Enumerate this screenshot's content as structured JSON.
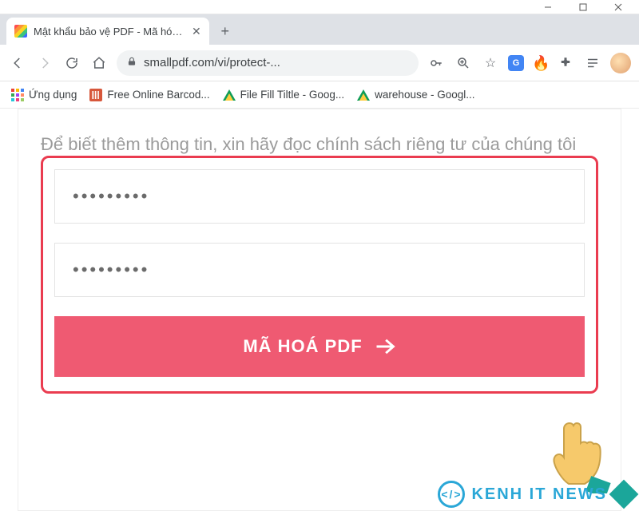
{
  "window": {
    "minimize": "–",
    "maximize": "▢",
    "close": "✕"
  },
  "tab": {
    "title": "Mật khẩu bảo vệ PDF - Mã hóa P"
  },
  "toolbar": {
    "url": "smallpdf.com/vi/protect-..."
  },
  "bookmarks": {
    "apps": "Ứng dụng",
    "barcode": "Free Online Barcod...",
    "filefill": "File Fill Tiltle - Goog...",
    "warehouse": "warehouse - Googl..."
  },
  "content": {
    "info": "Để biết thêm thông tin, xin hãy đọc chính sách riêng tư của chúng tôi",
    "password1": "•••••••••",
    "password2": "•••••••••",
    "cta_label": "MÃ HOÁ PDF"
  },
  "watermark": {
    "logo": "</>",
    "text": "KENH IT NEWS"
  },
  "colors": {
    "accent": "#ef5a72",
    "highlight_border": "#ea3c50",
    "muted_text": "#9b9b9b",
    "watermark": "#2aa7d7"
  }
}
